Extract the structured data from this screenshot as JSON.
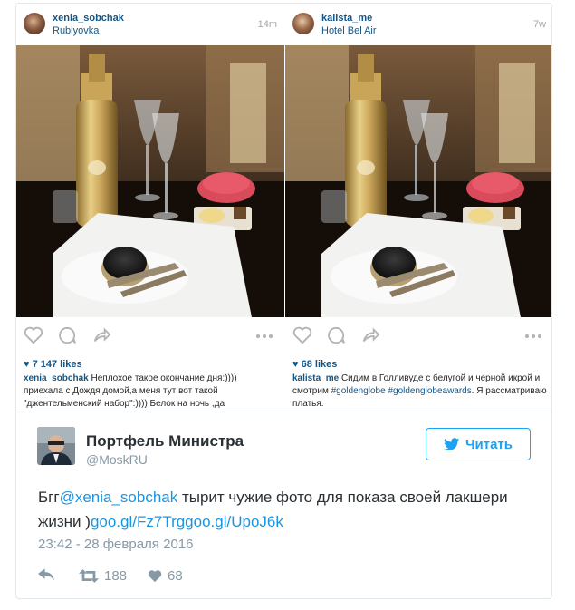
{
  "posts": [
    {
      "username": "xenia_sobchak",
      "location": "Rublyovka",
      "time": "14m",
      "likes": "7 147 likes",
      "caption_user": "xenia_sobchak",
      "caption_text": "Неплохое такое окончание дня:)))) приехала с Дождя домой,а меня тут вот такой \"джентельменский набор\":)))) Белок на ночь ,да"
    },
    {
      "username": "kalista_me",
      "location": "Hotel Bel Air",
      "time": "7w",
      "likes": "68 likes",
      "caption_user": "kalista_me",
      "caption_text": "Сидим в Голливуде с белугой и черной икрой и смотрим",
      "caption_tags": "#goldenglobe #goldenglobeawards",
      "caption_tail": ". Я рассматриваю платья."
    }
  ],
  "tweet": {
    "name": "Портфель Министра",
    "handle": "@MoskRU",
    "follow_label": "Читать",
    "text_prefix": "Бгг",
    "mention": "@xenia_sobchak",
    "text_body": " тырит чужие фото для показа своей лакшери жизни )",
    "links": "goo.gl/Fz7Trggoo.gl/UpoJ6k",
    "date": "23:42 - 28 февраля 2016",
    "retweets": "188",
    "likes": "68"
  },
  "colors": {
    "ig_link": "#125688",
    "twitter_blue": "#1da1f2",
    "twitter_gray": "#8899a6"
  },
  "icons": [
    "heart-icon",
    "comment-icon",
    "share-icon",
    "more-icon",
    "reply-icon",
    "retweet-icon",
    "twitter-bird-icon"
  ]
}
